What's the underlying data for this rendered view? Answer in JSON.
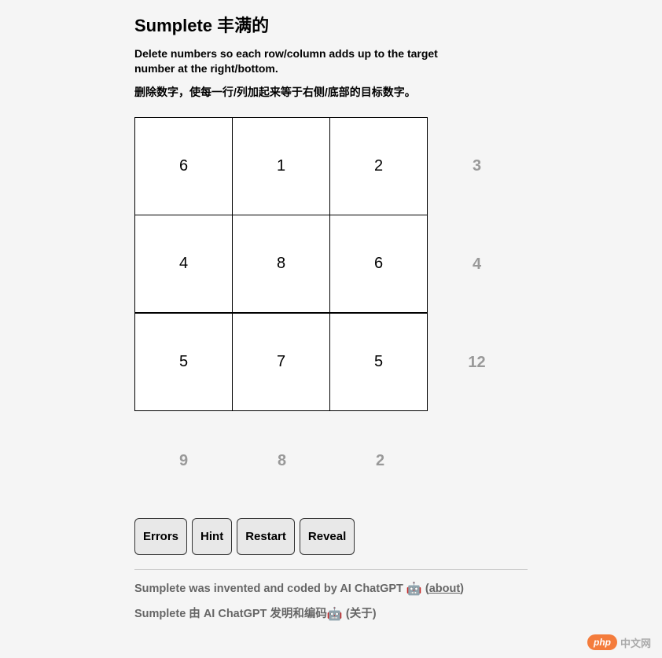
{
  "title": "Sumplete 丰满的",
  "instructions_en": "Delete numbers so each row/column adds up to the target number at the right/bottom.",
  "instructions_zh": "删除数字，使每一行/列加起来等于右侧/底部的目标数字。",
  "grid": {
    "cells": [
      [
        "6",
        "1",
        "2"
      ],
      [
        "4",
        "8",
        "6"
      ],
      [
        "5",
        "7",
        "5"
      ]
    ],
    "row_targets": [
      "3",
      "4",
      "12"
    ],
    "col_targets": [
      "9",
      "8",
      "2"
    ]
  },
  "buttons": {
    "errors": "Errors",
    "hint": "Hint",
    "restart": "Restart",
    "reveal": "Reveal"
  },
  "footer": {
    "line1_prefix": "Sumplete was invented and coded by AI ChatGPT ",
    "line1_paren_open": " (",
    "about_label": "about",
    "line1_paren_close": ")",
    "line2_prefix": "Sumplete 由 AI ChatGPT 发明和编码",
    "line2_suffix": "  (关于)"
  },
  "icons": {
    "robot": "🤖"
  },
  "watermark": {
    "badge": "php",
    "text": "中文网"
  }
}
